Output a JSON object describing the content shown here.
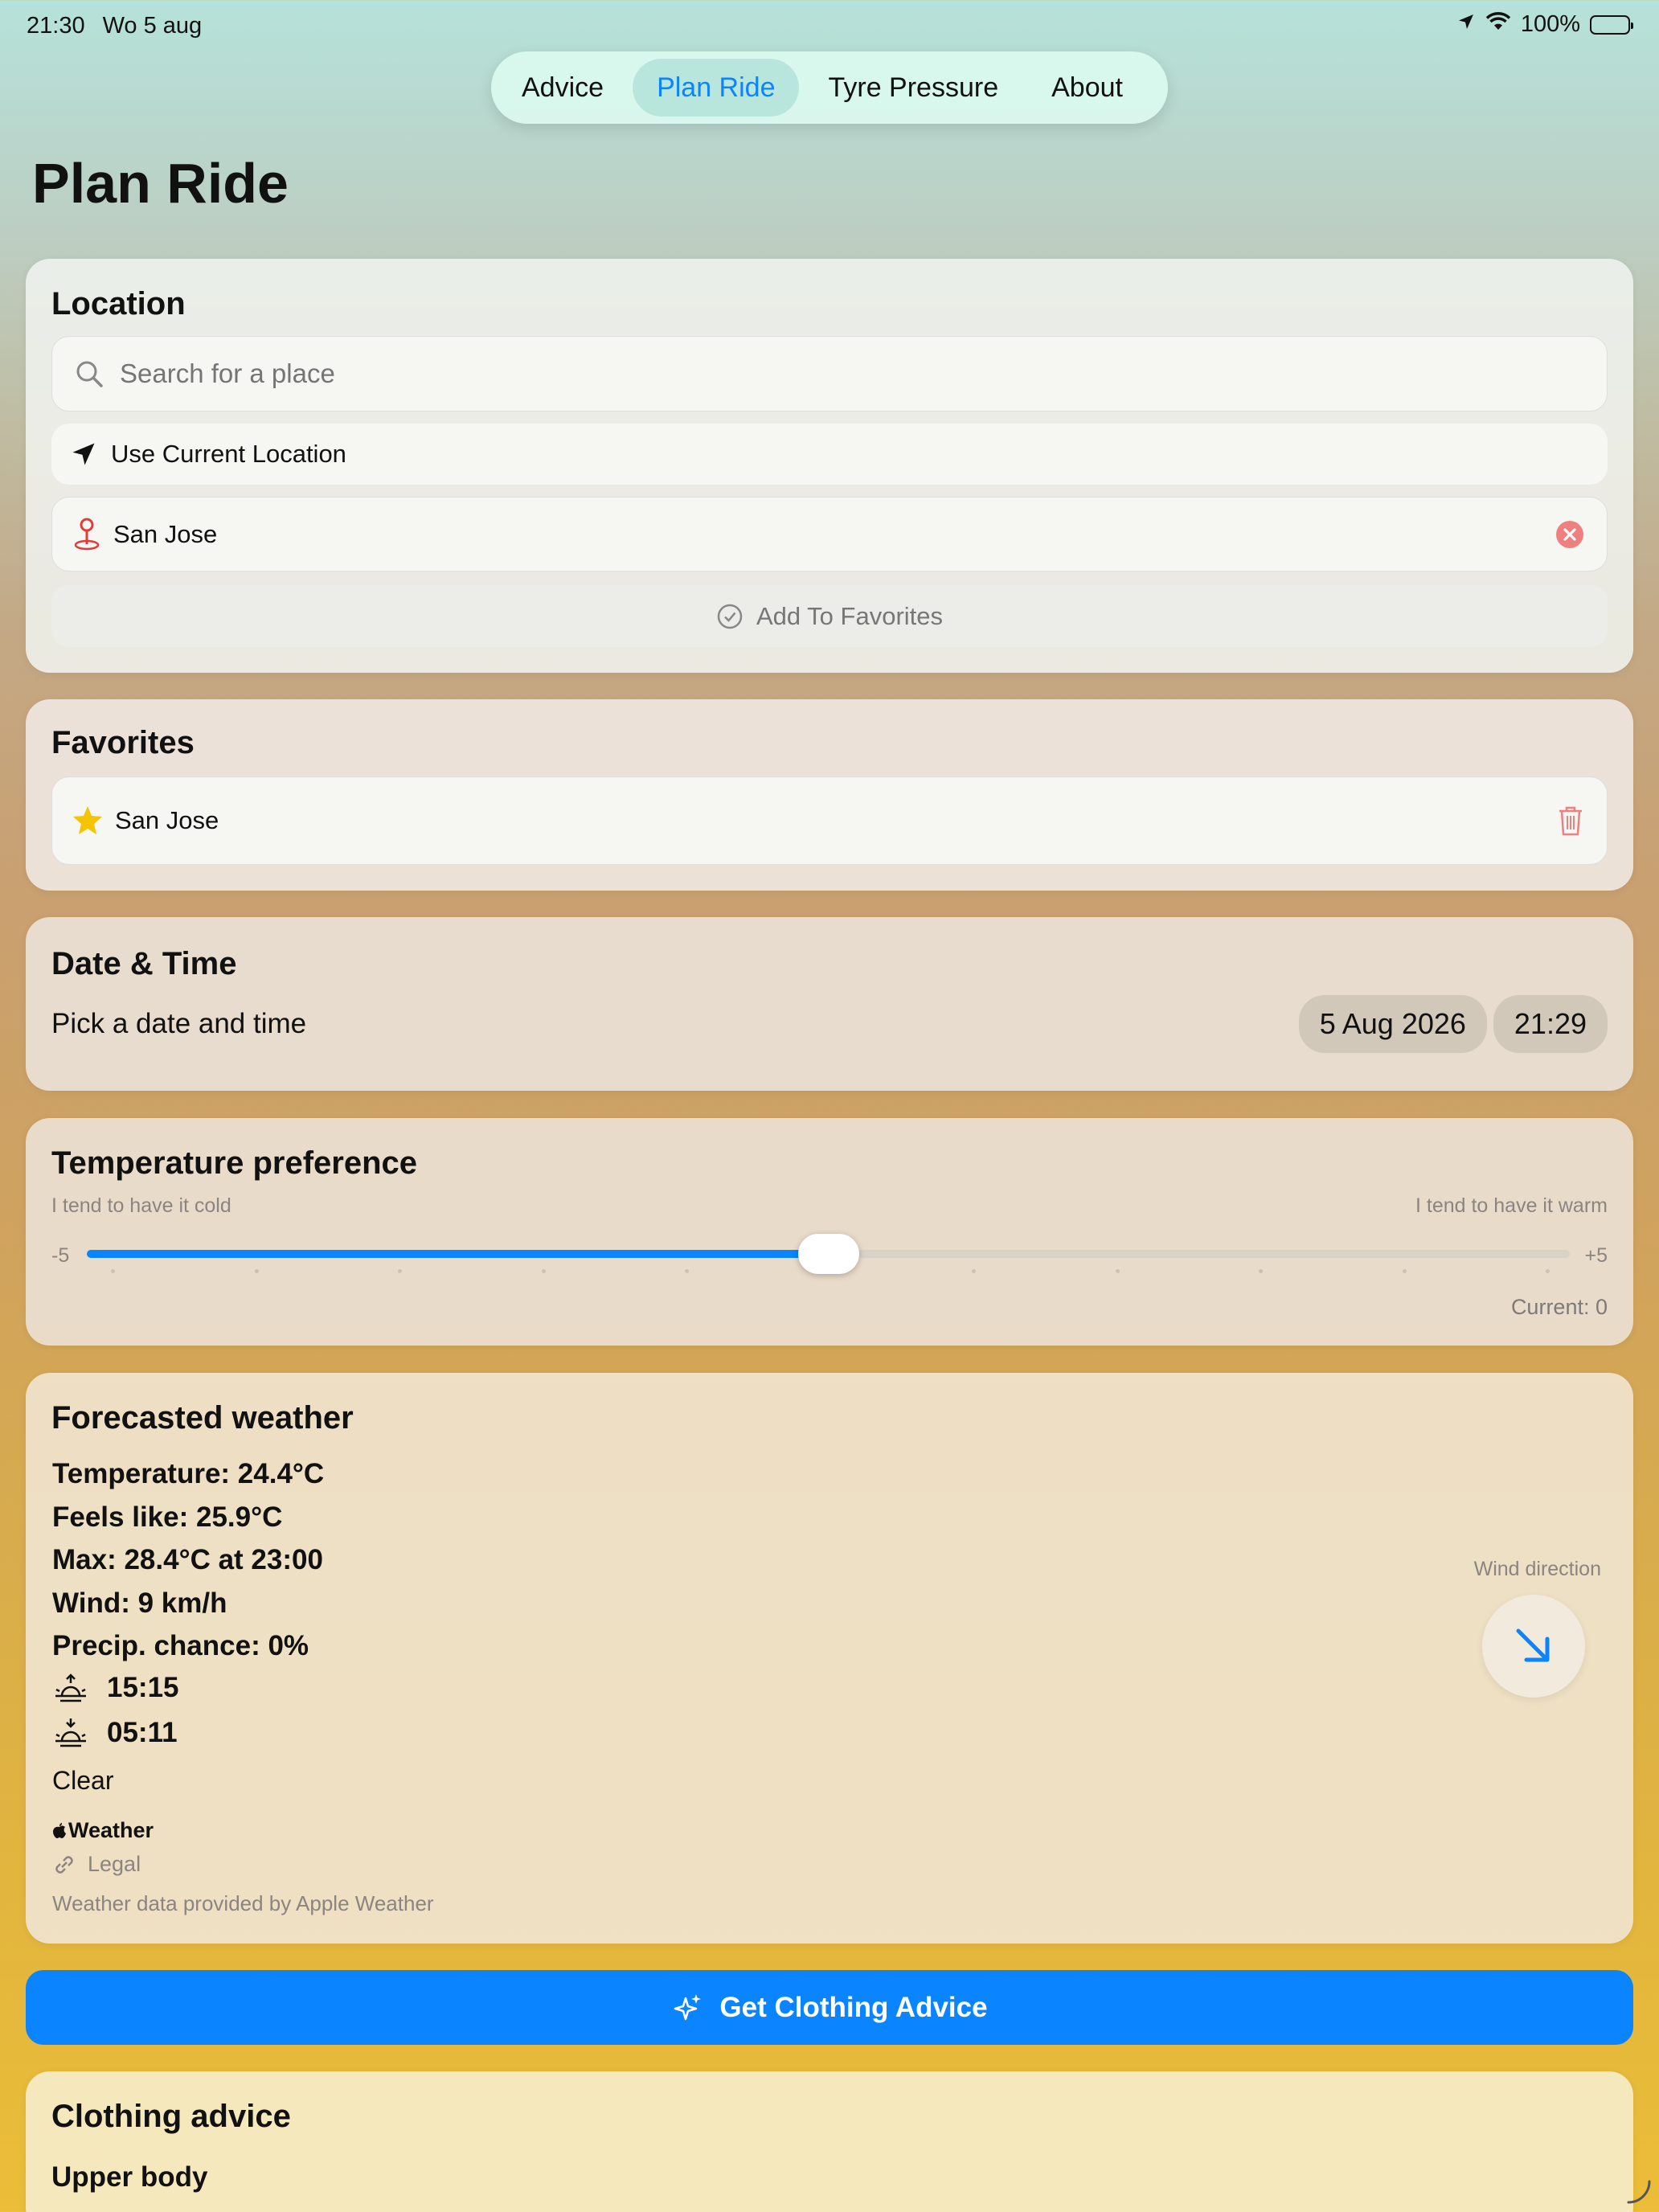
{
  "status": {
    "time": "21:30",
    "date": "Wo 5 aug",
    "battery": "100%"
  },
  "tabs": [
    {
      "label": "Advice"
    },
    {
      "label": "Plan Ride"
    },
    {
      "label": "Tyre Pressure"
    },
    {
      "label": "About"
    }
  ],
  "page": {
    "title": "Plan Ride"
  },
  "location": {
    "title": "Location",
    "search_placeholder": "Search for a place",
    "use_current": "Use Current Location",
    "selected": "San Jose",
    "add_favorite": "Add To Favorites"
  },
  "favorites": {
    "title": "Favorites",
    "items": [
      {
        "name": "San Jose"
      }
    ]
  },
  "datetime": {
    "title": "Date & Time",
    "label": "Pick a date and time",
    "date": "5 Aug 2026",
    "time": "21:29"
  },
  "temperature_pref": {
    "title": "Temperature preference",
    "left_hint": "I tend to have it cold",
    "right_hint": "I tend to have it warm",
    "min_label": "-5",
    "max_label": "+5",
    "min": -5,
    "max": 5,
    "value": 0,
    "current_label": "Current: 0"
  },
  "weather": {
    "title": "Forecasted weather",
    "temperature": "Temperature: 24.4°C",
    "feels_like": "Feels like: 25.9°C",
    "max": "Max: 28.4°C at 23:00",
    "wind": "Wind: 9 km/h",
    "precip": "Precip. chance: 0%",
    "sunrise": "15:15",
    "sunset": "05:11",
    "condition": "Clear",
    "brand": "Weather",
    "legal": "Legal",
    "attribution": "Weather data provided by Apple Weather",
    "wind_direction_label": "Wind direction",
    "wind_direction_icon": "arrow-down-right-icon"
  },
  "cta": {
    "label": "Get Clothing Advice"
  },
  "clothing": {
    "title": "Clothing advice",
    "section_upper": "Upper body"
  },
  "colors": {
    "accent": "#0a84ff",
    "danger": "#ef5b5b",
    "star": "#f5c400"
  }
}
